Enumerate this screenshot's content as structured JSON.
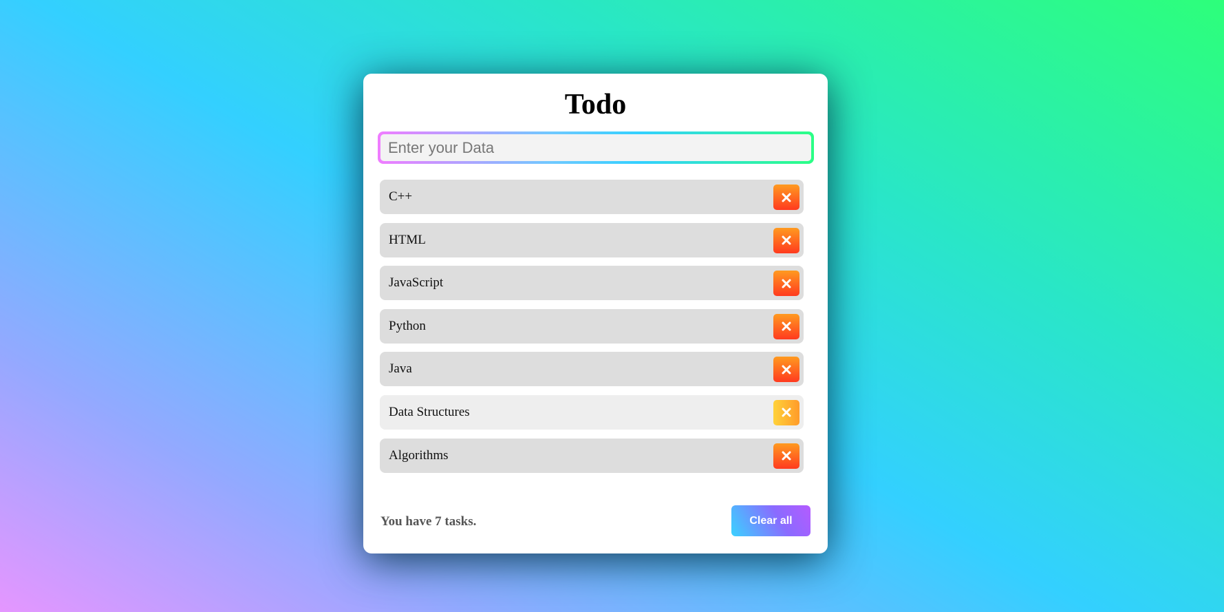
{
  "app": {
    "title": "Todo"
  },
  "input": {
    "placeholder": "Enter your Data",
    "value": ""
  },
  "tasks": [
    {
      "label": "C++",
      "hovered": false
    },
    {
      "label": "HTML",
      "hovered": false
    },
    {
      "label": "JavaScript",
      "hovered": false
    },
    {
      "label": "Python",
      "hovered": false
    },
    {
      "label": "Java",
      "hovered": false
    },
    {
      "label": "Data Structures",
      "hovered": true
    },
    {
      "label": "Algorithms",
      "hovered": false
    }
  ],
  "footer": {
    "count_text": "You have 7 tasks.",
    "clear_label": "Clear all"
  },
  "icons": {
    "delete": "close-icon"
  },
  "colors": {
    "delete_button": "#ff3a1f",
    "delete_button_hover": "#ffb12e",
    "item_bg": "#dddddd",
    "item_bg_hover": "#eeeeee",
    "clear_button": "#8a6bff"
  }
}
